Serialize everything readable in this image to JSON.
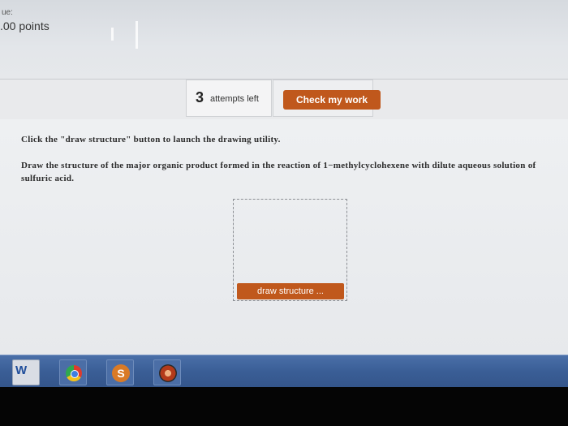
{
  "header": {
    "due_label": "ue:",
    "points_label": ".00 points"
  },
  "attempts": {
    "count": "3",
    "label": "attempts left",
    "check_button": "Check my work"
  },
  "instructions": {
    "line1": "Click the \"draw structure\" button to launch the drawing utility.",
    "line2": "Draw the structure of the major organic product formed in the reaction of 1−methylcyclohexene with dilute aqueous solution of sulfuric acid."
  },
  "drawing": {
    "button_label": "draw structure ..."
  },
  "taskbar": {
    "items": [
      {
        "name": "word-icon",
        "glyph": "W"
      },
      {
        "name": "chrome-icon"
      },
      {
        "name": "s-app-icon",
        "glyph": "S"
      },
      {
        "name": "app-icon"
      }
    ]
  },
  "colors": {
    "accent": "#c0581c",
    "taskbar": "#3a5e96"
  }
}
